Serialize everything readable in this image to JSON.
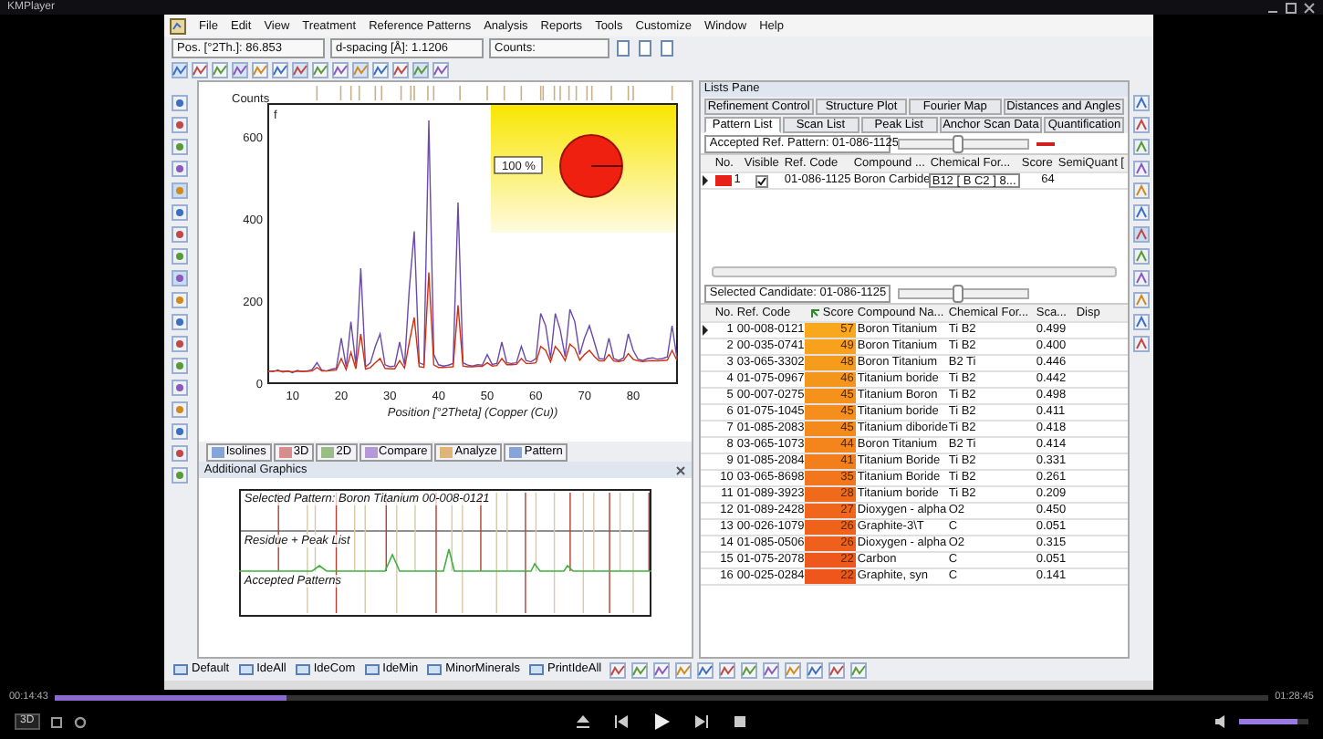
{
  "player": {
    "title": "KMPlayer",
    "elapsed": "00:14:43",
    "total": "01:28:45",
    "progress": {
      "level": 0.19
    },
    "volume": {
      "level": 0.85
    },
    "mode_button": "3D"
  },
  "menu": [
    "File",
    "Edit",
    "View",
    "Treatment",
    "Reference Patterns",
    "Analysis",
    "Reports",
    "Tools",
    "Customize",
    "Window",
    "Help"
  ],
  "status_fields": [
    "Pos. [°2Th.]: 86.853",
    "d-spacing [Å]: 1.1206",
    "Counts:"
  ],
  "chart": {
    "inset_label": "100 %",
    "corner_label": "f",
    "chart_data": {
      "type": "line",
      "ylabel": "Counts",
      "xlabel": "Position [°2Theta] (Copper (Cu))",
      "xlim": [
        5,
        89
      ],
      "ylim": [
        0,
        680
      ],
      "xticks": [
        10,
        20,
        30,
        40,
        50,
        60,
        70,
        80
      ],
      "yticks": [
        0,
        200,
        400,
        600
      ],
      "x": [
        5,
        6,
        7,
        8,
        9,
        10,
        11,
        12,
        13,
        14,
        15,
        16,
        17,
        18,
        19,
        20,
        21,
        22,
        23,
        24,
        25,
        26,
        27,
        28,
        29,
        30,
        31,
        32,
        33,
        34,
        35,
        36,
        37,
        38,
        39,
        40,
        41,
        42,
        43,
        44,
        45,
        46,
        47,
        48,
        49,
        50,
        51,
        52,
        53,
        54,
        55,
        56,
        57,
        58,
        59,
        60,
        61,
        62,
        63,
        64,
        65,
        66,
        67,
        68,
        69,
        70,
        71,
        72,
        73,
        74,
        75,
        76,
        77,
        78,
        79,
        80,
        81,
        82,
        83,
        84,
        85,
        86,
        87,
        88,
        89
      ],
      "series": [
        {
          "color": "#6a4aaa",
          "values": [
            30,
            28,
            32,
            27,
            30,
            26,
            31,
            28,
            30,
            33,
            50,
            32,
            30,
            34,
            36,
            110,
            40,
            150,
            45,
            280,
            40,
            50,
            90,
            120,
            45,
            40,
            42,
            100,
            45,
            230,
            370,
            50,
            45,
            640,
            70,
            45,
            42,
            44,
            48,
            440,
            50,
            44,
            42,
            45,
            44,
            70,
            46,
            48,
            100,
            50,
            48,
            50,
            90,
            55,
            52,
            60,
            170,
            140,
            60,
            170,
            130,
            65,
            180,
            150,
            70,
            110,
            140,
            100,
            60,
            58,
            110,
            60,
            55,
            62,
            120,
            80,
            58,
            55,
            60,
            62,
            58,
            60,
            64,
            140,
            60
          ]
        },
        {
          "color": "#d03010",
          "values": [
            29,
            30,
            30,
            29,
            29,
            28,
            29,
            29,
            29,
            30,
            38,
            30,
            30,
            31,
            32,
            60,
            33,
            75,
            35,
            120,
            34,
            38,
            50,
            60,
            36,
            35,
            35,
            55,
            37,
            100,
            160,
            40,
            38,
            270,
            45,
            38,
            38,
            39,
            40,
            190,
            42,
            40,
            40,
            41,
            41,
            50,
            42,
            43,
            60,
            45,
            45,
            46,
            60,
            48,
            48,
            50,
            90,
            80,
            52,
            90,
            75,
            55,
            95,
            85,
            56,
            70,
            80,
            65,
            54,
            54,
            70,
            54,
            53,
            55,
            72,
            58,
            54,
            53,
            54,
            55,
            54,
            55,
            56,
            80,
            55
          ]
        }
      ]
    }
  },
  "view_tabs": [
    "Isolines",
    "3D",
    "2D",
    "Compare",
    "Analyze",
    "Pattern"
  ],
  "additional_graphics": {
    "title": "Additional Graphics",
    "bands": [
      "Selected Pattern: Boron Titanium  00-008-0121",
      "Residue + Peak List",
      "Accepted Patterns"
    ]
  },
  "bottom_toolbar": [
    "Default",
    "IdeAll",
    "IdeCom",
    "IdeMin",
    "MinorMinerals",
    "PrintIdeAll"
  ],
  "lists_pane": {
    "title": "Lists Pane",
    "tabs_top": [
      {
        "label": "Refinement Control",
        "selected": false
      },
      {
        "label": "Structure Plot",
        "selected": false
      },
      {
        "label": "Fourier Map",
        "selected": false
      },
      {
        "label": "Distances and Angles",
        "selected": false
      }
    ],
    "tabs_bottom": [
      {
        "label": "Pattern List",
        "selected": true
      },
      {
        "label": "Scan List",
        "selected": false
      },
      {
        "label": "Peak List",
        "selected": false
      },
      {
        "label": "Anchor Scan Data",
        "selected": false
      },
      {
        "label": "Quantification",
        "selected": false
      }
    ],
    "accepted_label": "Accepted Ref. Pattern: 01-086-1125",
    "accepted_slider": {
      "level": 0.45
    },
    "accepted_columns": [
      "No.",
      "Visible",
      "Ref. Code",
      "Compound ...",
      "Chemical For...",
      "Score",
      "SemiQuant ["
    ],
    "accepted_rows": [
      {
        "no": "1",
        "color": "#e8201a",
        "visible": true,
        "ref_code": "01-086-1125",
        "compound": "Boron Carbide",
        "formula": "B12 [ B C2 ] 8...",
        "score": "64"
      }
    ],
    "candidate_label": "Selected Candidate: 01-086-1125",
    "candidate_slider": {
      "level": 0.45
    },
    "candidate_columns": [
      "No.",
      "Ref. Code",
      "Score",
      "Compound Na...",
      "Chemical For...",
      "Sca...",
      "Disp"
    ],
    "candidates": [
      {
        "no": "1",
        "ref_code": "00-008-0121",
        "score": "57",
        "color": "#f7a81c",
        "compound": "Boron Titanium",
        "formula": "Ti B2",
        "scale": "0.499"
      },
      {
        "no": "2",
        "ref_code": "00-035-0741",
        "score": "49",
        "color": "#f7a11c",
        "compound": "Boron Titanium",
        "formula": "Ti B2",
        "scale": "0.400"
      },
      {
        "no": "3",
        "ref_code": "03-065-3302",
        "score": "48",
        "color": "#f69c1c",
        "compound": "Boron Titanium",
        "formula": "B2 Ti",
        "scale": "0.446"
      },
      {
        "no": "4",
        "ref_code": "01-075-0967",
        "score": "46",
        "color": "#f5961c",
        "compound": "Titanium boride",
        "formula": "Ti B2",
        "scale": "0.442"
      },
      {
        "no": "5",
        "ref_code": "00-007-0275",
        "score": "45",
        "color": "#f5921c",
        "compound": "Titanium Boron",
        "formula": "Ti B2",
        "scale": "0.498"
      },
      {
        "no": "6",
        "ref_code": "01-075-1045",
        "score": "45",
        "color": "#f58e1c",
        "compound": "Titanium boride",
        "formula": "Ti B2",
        "scale": "0.411"
      },
      {
        "no": "7",
        "ref_code": "01-085-2083",
        "score": "45",
        "color": "#f48a1c",
        "compound": "Titanium diboride",
        "formula": "Ti B2",
        "scale": "0.418"
      },
      {
        "no": "8",
        "ref_code": "03-065-1073",
        "score": "44",
        "color": "#f4851c",
        "compound": "Boron Titanium",
        "formula": "B2 Ti",
        "scale": "0.414"
      },
      {
        "no": "9",
        "ref_code": "01-085-2084",
        "score": "41",
        "color": "#f37e1c",
        "compound": "Titanium Boride",
        "formula": "Ti B2",
        "scale": "0.331"
      },
      {
        "no": "10",
        "ref_code": "03-065-8698",
        "score": "35",
        "color": "#f2761c",
        "compound": "Titanium Boride",
        "formula": "Ti B2",
        "scale": "0.261"
      },
      {
        "no": "11",
        "ref_code": "01-089-3923",
        "score": "28",
        "color": "#f06a1c",
        "compound": "Titanium boride",
        "formula": "Ti B2",
        "scale": "0.209"
      },
      {
        "no": "12",
        "ref_code": "01-089-2428",
        "score": "27",
        "color": "#f0661c",
        "compound": "Dioxygen - alpha",
        "formula": "O2",
        "scale": "0.450"
      },
      {
        "no": "13",
        "ref_code": "00-026-1079",
        "score": "26",
        "color": "#ef621c",
        "compound": "Graphite-3\\T",
        "formula": "C",
        "scale": "0.051"
      },
      {
        "no": "14",
        "ref_code": "01-085-0506",
        "score": "26",
        "color": "#ef601c",
        "compound": "Dioxygen - alpha",
        "formula": "O2",
        "scale": "0.315"
      },
      {
        "no": "15",
        "ref_code": "01-075-2078",
        "score": "22",
        "color": "#ee581c",
        "compound": "Carbon",
        "formula": "C",
        "scale": "0.051"
      },
      {
        "no": "16",
        "ref_code": "00-025-0284",
        "score": "22",
        "color": "#ee561c",
        "compound": "Graphite, syn",
        "formula": "C",
        "scale": "0.141"
      }
    ]
  }
}
